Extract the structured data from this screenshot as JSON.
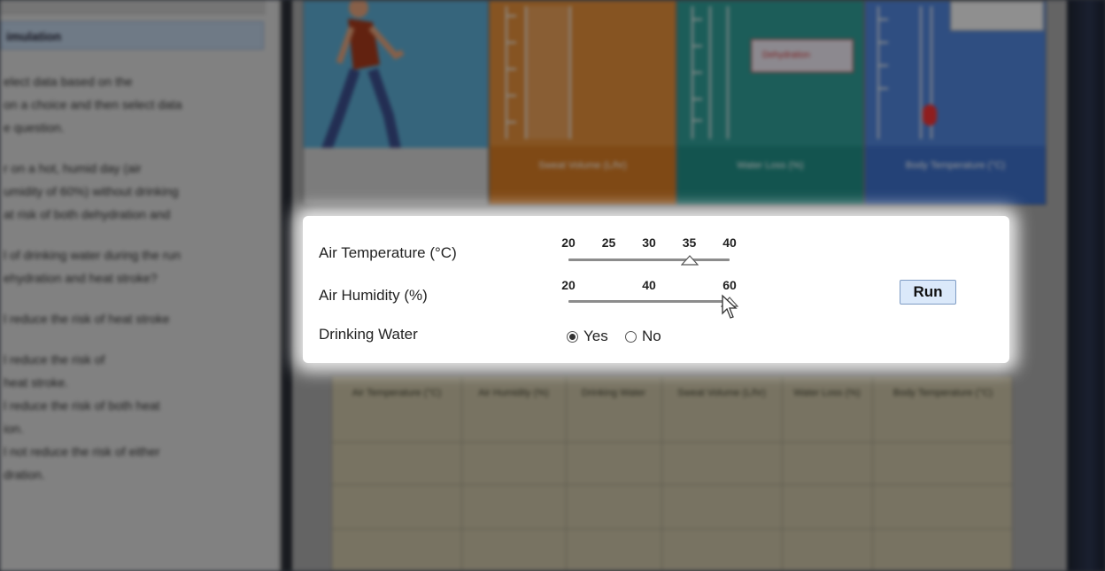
{
  "background_app": {
    "panel_title": "imulation",
    "panel_lines": [
      "elect data based on the",
      "on a choice and then select data",
      "e question.",
      "",
      "r on a hot, humid day (air",
      "umidity of 60%) without drinking",
      "at risk of both dehydration and",
      "",
      "l of drinking water during the run",
      "ehydration and heat stroke?",
      "",
      "l reduce the risk of heat stroke",
      "",
      "l reduce the risk of",
      "heat stroke.",
      "l reduce the risk of both heat",
      "ion.",
      "l not reduce the risk of either",
      "dration."
    ],
    "tiles": [
      {
        "label": "",
        "caption": ""
      },
      {
        "label": "sweat-volume",
        "caption": "Sweat Volume (L/hr)"
      },
      {
        "label": "water-loss",
        "caption": "Water Loss (%)"
      },
      {
        "label": "body-temperature",
        "caption": "Body Temperature (°C)"
      }
    ],
    "dehydration_label": "Dehydration",
    "table_headers": [
      "Air Temperature (°C)",
      "Air Humidity (%)",
      "Drinking Water",
      "Sweat Volume (L/hr)",
      "Water Loss (%)",
      "Body Temperature (°C)"
    ]
  },
  "controls": {
    "temperature": {
      "label": "Air Temperature (°C)",
      "ticks": [
        "20",
        "25",
        "30",
        "35",
        "40"
      ],
      "value": 35
    },
    "humidity": {
      "label": "Air Humidity (%)",
      "ticks": [
        "20",
        "40",
        "60"
      ],
      "value": 60
    },
    "drinking_water": {
      "label": "Drinking Water",
      "options": [
        "Yes",
        "No"
      ],
      "selected": "Yes"
    },
    "run_label": "Run"
  },
  "colors": {
    "run_button_bg": "#dbe9fa",
    "sweat_tile": "#e08c3a",
    "water_tile": "#2f9c94",
    "body_tile": "#4f82d8",
    "runner_tile": "#5aa9cf"
  }
}
